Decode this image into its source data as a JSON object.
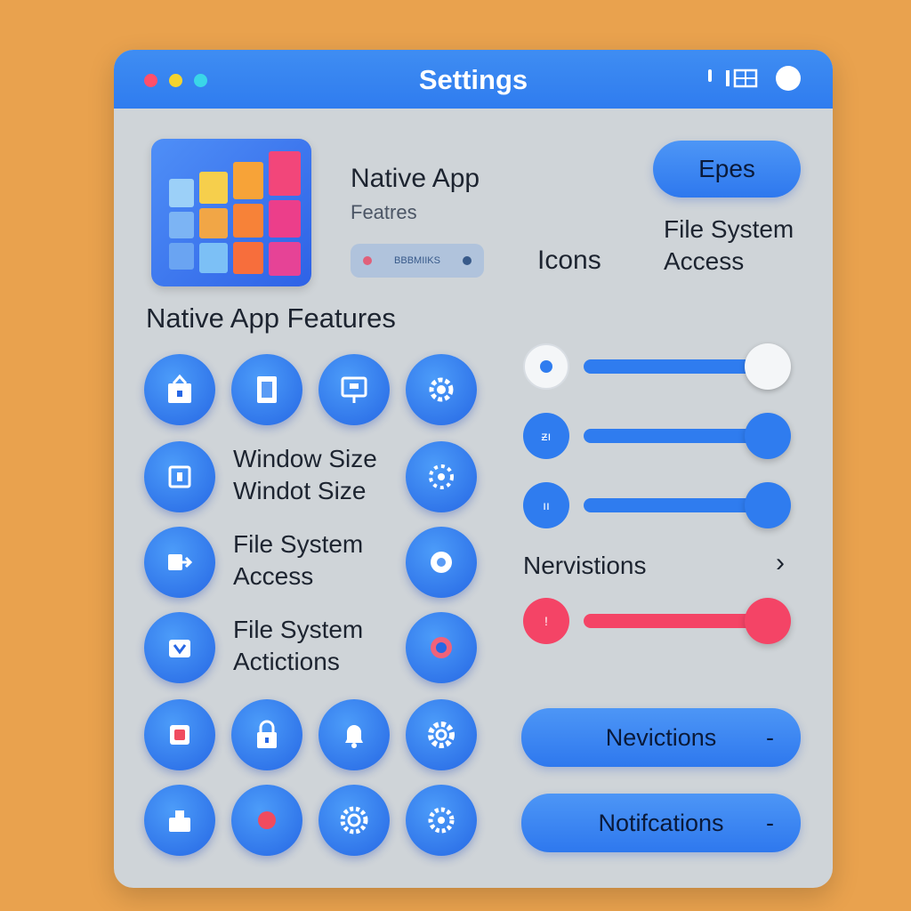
{
  "window": {
    "title": "Settings",
    "controls": [
      "red",
      "yellow",
      "cyan"
    ]
  },
  "header": {
    "app_name_line1": "Native App",
    "app_name_line2": "Featres",
    "small_pill_label": "BBBMIIKS",
    "top_button_label": "Epes",
    "icons_label": "Icons",
    "file_system_label_line1": "File System",
    "file_system_label_line2": "Access"
  },
  "section": {
    "heading": "Native App Features"
  },
  "features": {
    "window_size_line1": "Window Size",
    "window_size_line2": "Windot Size",
    "file_access_line1": "File System",
    "file_access_line2": "Access",
    "file_actions_line1": "File System",
    "file_actions_line2": "Actictions"
  },
  "sliders": [
    {
      "name": "slider-1",
      "icon_text": "",
      "level": 0.9,
      "color": "#2f7cef",
      "knob": "white"
    },
    {
      "name": "slider-2",
      "icon_text": "ƶı",
      "level": 0.9,
      "color": "#2f7cef",
      "knob": "blue"
    },
    {
      "name": "slider-3",
      "icon_text": "ıı",
      "level": 0.9,
      "color": "#2f7cef",
      "knob": "blue"
    },
    {
      "name": "slider-4",
      "icon_text": "!",
      "level": 0.9,
      "color": "#f44466",
      "knob": "red"
    }
  ],
  "nervistions": {
    "label": "Nervistions",
    "chevron": "›"
  },
  "buttons": {
    "nevictions_label": "Nevictions",
    "notifications_label": "Notifcations",
    "dash": "-"
  },
  "colors": {
    "accent": "#2f7cef",
    "danger": "#f44466",
    "background": "#e9a24e",
    "panel": "#cfd4d8"
  }
}
